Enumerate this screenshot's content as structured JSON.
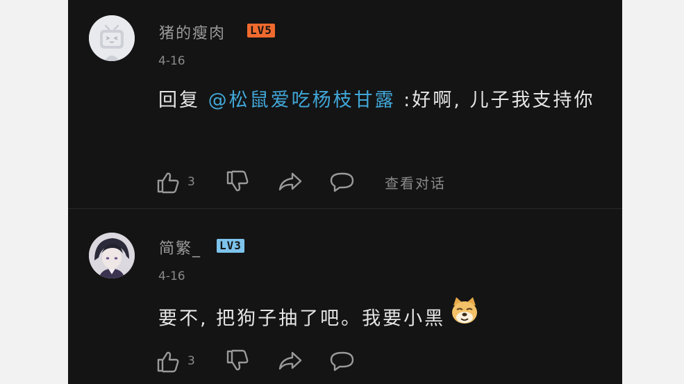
{
  "comments": [
    {
      "username": "猪的瘦肉",
      "level": "LV5",
      "date": "4-16",
      "reply_prefix": "回复 ",
      "mention": "@松鼠爱吃杨枝甘露",
      "text": " :好啊, 儿子我支持你",
      "likes": "3",
      "view_conversation": "查看对话",
      "avatar_icon": "bilibili-tv-default-avatar-icon"
    },
    {
      "username": "简繁_",
      "level": "LV3",
      "date": "4-16",
      "text": "要不, 把狗子抽了吧。我要小黑",
      "emoji": "doge-emoji",
      "likes": "3",
      "avatar_icon": "anime-character-avatar"
    }
  ],
  "colors": {
    "background": "#141414",
    "mention": "#41a7d8",
    "lv5": "#f06a2e",
    "lv3": "#7dc3ec"
  }
}
